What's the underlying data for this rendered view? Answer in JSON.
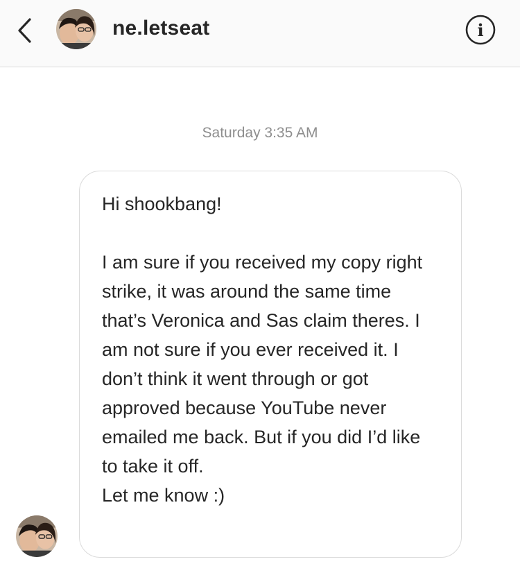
{
  "header": {
    "username": "ne.letseat",
    "back_icon": "chevron-left-icon",
    "info_icon": "info-icon",
    "info_glyph": "i"
  },
  "thread": {
    "timestamp": "Saturday 3:35 AM",
    "messages": [
      {
        "text": "Hi shookbang!\n\nI am sure if you received my copy right strike, it was around the same time that’s Veronica and Sas claim theres. I am not sure if you ever received it. I don’t think it went through or got approved because YouTube never emailed me back. But if you did I’d like to take it off.\nLet me know :)"
      }
    ]
  },
  "colors": {
    "text": "#262626",
    "muted": "#8e8e8e",
    "border": "#dbdbdb",
    "header_bg": "#fafafa"
  }
}
